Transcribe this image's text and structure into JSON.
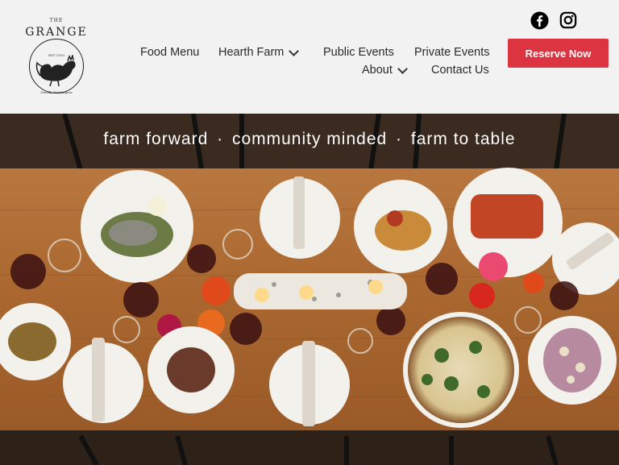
{
  "logo": {
    "the": "THE",
    "name": "GRANGE",
    "est": "EST 1910",
    "location": "Duvall, Washington"
  },
  "social": {
    "icons": [
      "facebook-icon",
      "instagram-icon"
    ]
  },
  "nav": {
    "row1": [
      {
        "label": "Food Menu",
        "dropdown": false
      },
      {
        "label": "Hearth Farm",
        "dropdown": true
      },
      {
        "label": "Public Events",
        "dropdown": false
      },
      {
        "label": "Private Events",
        "dropdown": false
      }
    ],
    "row2": [
      {
        "label": "About",
        "dropdown": true
      },
      {
        "label": "Contact Us",
        "dropdown": false
      }
    ]
  },
  "cta": {
    "label": "Reserve Now",
    "color": "#dc3440"
  },
  "hero": {
    "tagline": [
      "farm forward",
      "community minded",
      "farm to table"
    ],
    "separator": "·"
  }
}
